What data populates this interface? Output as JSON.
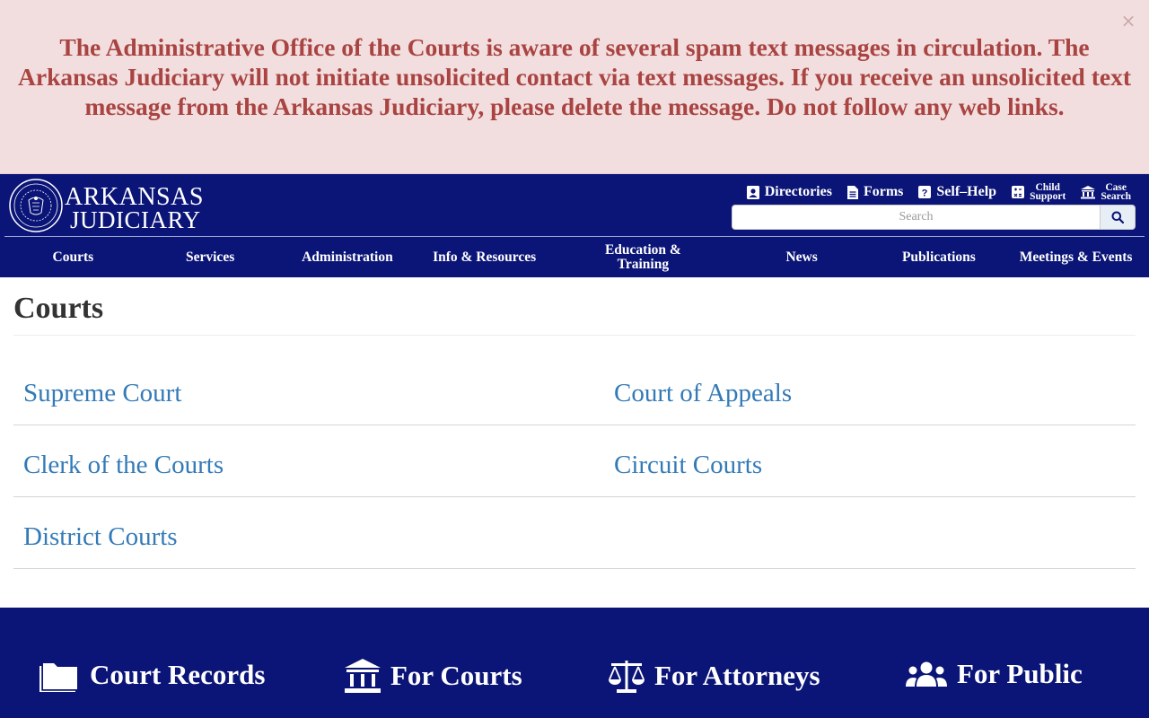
{
  "alert": {
    "message": "The Administrative Office of the Courts is aware of several spam text messages in circulation. The Arkansas Judiciary will not initiate unsolicited contact via text messages. If you receive an unsolicited text message from the Arkansas Judiciary, please delete the message. Do not follow any web links.",
    "close_symbol": "×",
    "colors": {
      "background": "#f2dede",
      "text": "#a94442"
    }
  },
  "header": {
    "logo": {
      "line1": "ARKANSAS",
      "line2": "JUDICIARY",
      "seal_icon": "supreme-court-seal"
    },
    "utility_links": [
      {
        "label": "Directories",
        "icon": "directory-icon"
      },
      {
        "label": "Forms",
        "icon": "document-icon"
      },
      {
        "label": "Self–Help",
        "icon": "question-icon"
      },
      {
        "label_line1": "Child",
        "label_line2": "Support",
        "icon": "calculator-icon"
      },
      {
        "label_line1": "Case",
        "label_line2": "Search",
        "icon": "courthouse-icon"
      }
    ],
    "search": {
      "placeholder": "Search",
      "button_icon": "search-icon"
    },
    "nav": [
      {
        "label": "Courts"
      },
      {
        "label": "Services"
      },
      {
        "label": "Administration"
      },
      {
        "label": "Info & Resources"
      },
      {
        "label": "Education & Training"
      },
      {
        "label": "News"
      },
      {
        "label": "Publications"
      },
      {
        "label": "Meetings & Events"
      }
    ],
    "colors": {
      "background": "#0b1577"
    }
  },
  "main": {
    "title": "Courts",
    "links": [
      {
        "left": "Supreme Court",
        "right": "Court of Appeals"
      },
      {
        "left": "Clerk of the Courts",
        "right": "Circuit Courts"
      },
      {
        "left": "District Courts",
        "right": ""
      }
    ],
    "colors": {
      "link": "#337ab7"
    }
  },
  "footer": {
    "items": [
      {
        "label": "Court Records",
        "icon": "folder-icon"
      },
      {
        "label": "For Courts",
        "icon": "courthouse-icon"
      },
      {
        "label": "For Attorneys",
        "icon": "scales-icon"
      },
      {
        "label": "For Public",
        "icon": "users-icon"
      }
    ]
  }
}
